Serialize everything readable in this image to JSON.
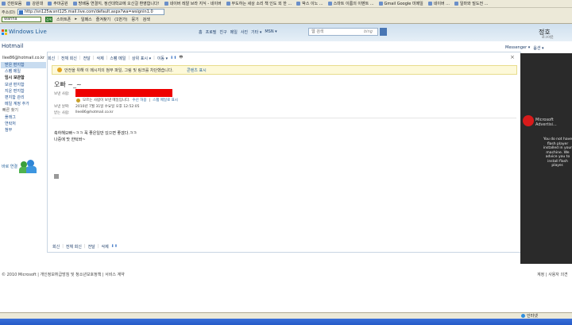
{
  "browser": {
    "bookmarks": [
      "간판모음",
      "강원대",
      "주마공원",
      "방배동 연결지, 정선대학교에 오신걸 환영합니다!",
      "네이버 레알 브라 지식 -  네이버",
      "무도하는 세상 소리 책 인도 외 한 ...",
      "박스 이노 ...",
      "스마트 이름의 이벤트 ...",
      "Gmail Google 미메일",
      "네이버 ...",
      "일마와 빌도전 ..."
    ],
    "address_label": "주소(D)",
    "address_url": "http://sn125w.snt125.mail.live.com/default.aspx?wa=wsignin1.0",
    "toolbar_search": "wanna",
    "toolbar_go": "검색",
    "toolbar_items": [
      "스마트폰",
      "▸",
      "일페스",
      "즐겨찾기",
      "(1번가)",
      "뭉기",
      "검색"
    ]
  },
  "header": {
    "logo_text": "Windows Live",
    "nav": [
      "홈",
      "프로필",
      "친구",
      "메일",
      "사진",
      "기타 ▾",
      "MSN ▾"
    ],
    "search_placeholder": "웹 검색",
    "bing_label": "bing",
    "user_name": "정호",
    "user_status": "로그아웃"
  },
  "sidebar": {
    "title": "Hotmail",
    "email": "llee86@hotmail.co.kr",
    "folders": [
      {
        "label": "받은 편지함",
        "state": "selected"
      },
      {
        "label": "스팸 메일",
        "state": "normal"
      },
      {
        "label": "임시 보관함",
        "state": "bold"
      },
      {
        "label": "보낸 편지함",
        "state": "normal"
      },
      {
        "label": "지운 편지함",
        "state": "normal"
      },
      {
        "label": "편지함 관리",
        "state": "normal"
      },
      {
        "label": "메일 계정 추가",
        "state": "normal"
      },
      {
        "label": "빠른 찾기",
        "state": "section"
      },
      {
        "label": "플래그",
        "state": "sub"
      },
      {
        "label": "연락처",
        "state": "sub"
      },
      {
        "label": "첨부",
        "state": "sub"
      }
    ],
    "contacts_label": "바로 연결"
  },
  "message_toolbar": {
    "items": [
      "회신",
      "전체 회신",
      "전달",
      "삭제",
      "스팸 메일",
      "상위 표시 ▾",
      "이동 ▾"
    ],
    "right_items": [
      "Messenger ▾",
      "옵션 ▾"
    ],
    "close": "×"
  },
  "safety_bar": {
    "text": "안전을 위해 이 메시지의 첨부 파일, 그림 및 링크를 차단했습니다.",
    "link": "콘텐츠 표시"
  },
  "message": {
    "subject": "오빠 ~_~",
    "from_label": "보낸 사람:",
    "sender_warning": "모르는 사람이 보낸 메일입니다.",
    "sender_links": [
      "수신 허용",
      "스팸 메일로 표시"
    ],
    "date_label": "보낸 날짜:",
    "date_value": "2010년 7월 31일 수요일 오후 12:52:05",
    "to_label": "받는 사람:",
    "to_value": "llee86@hotmail.co.kr",
    "body_lines": [
      "축하해오빠~ㅋㅋ 꼭 좋은일만 있으면 좋겠다.ㅋㅋ",
      "나중에 맛 한턱쏴~"
    ]
  },
  "bottom_toolbar": {
    "items": [
      "회신",
      "전체 회신",
      "전달",
      "삭제"
    ]
  },
  "ad": {
    "brand_lines": [
      "Microsoft",
      "Advertisi..."
    ],
    "text": "You do not have flash player installed in your machine. We advice you to install flash player."
  },
  "footer": {
    "left": "© 2010 Microsoft | 개인정보취급방침 및 청소년보호정책 | 서비스 계약",
    "right": "계정 | 사용자 의견"
  },
  "status": {
    "zone": "인터넷"
  }
}
